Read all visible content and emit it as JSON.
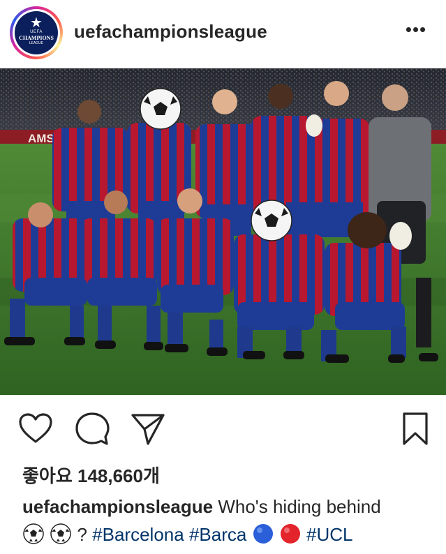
{
  "post": {
    "avatar": {
      "star": "★",
      "uefa": "UEFA",
      "line1": "CHAMPIONS",
      "line2": "LEAGUE"
    },
    "username": "uefachampionsleague",
    "more_label": "•••",
    "photo": {
      "stadium_banner": "AMST",
      "description_icon": "team-photo"
    },
    "likes": {
      "label": "좋아요 148,660개"
    },
    "caption": {
      "username": "uefachampionsleague",
      "text1": "Who's hiding behind",
      "emoji1": "⚽",
      "emoji2": "⚽",
      "text2": "?",
      "tag1": "#Barcelona",
      "tag2": "#Barca",
      "emoji_blue": "🔵",
      "emoji_red": "🔴",
      "tag3": "#UCL"
    }
  },
  "colors": {
    "blaugrana_blue": "#1e3c96",
    "blaugrana_red": "#b8182f",
    "pitch": "#3f7a2c",
    "tag_blue": "#003569"
  }
}
